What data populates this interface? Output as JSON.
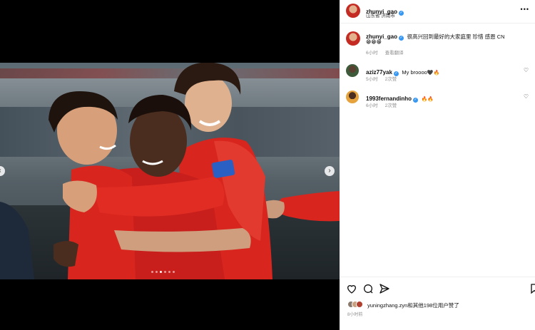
{
  "post": {
    "author": "zhunyi_gao",
    "location": "山东省 济南市",
    "caption_author": "zhunyi_gao",
    "caption": "很高兴回到最好的大家庭里 珍惜 感恩 CN",
    "caption_emojis": "😁😁😁",
    "caption_time": "6小时",
    "caption_translate": "查看翻译",
    "more_icon": "more-horizontal-icon"
  },
  "comments": [
    {
      "user": "aziz77yak",
      "text": "My broooo",
      "emojis": "🖤🔥",
      "time": "5小时",
      "likes": "2次赞"
    },
    {
      "user": "1993fernandinho",
      "text": "",
      "emojis": "🔥🔥",
      "time": "6小时",
      "likes": "2次赞"
    }
  ],
  "footer": {
    "liked_by": "yuningzhang.zyn和其他198位用户赞了",
    "time": "8小时前"
  },
  "colors": {
    "jersey": "#d8261f",
    "verified": "#3897f0",
    "muted": "#8e8e8e"
  }
}
